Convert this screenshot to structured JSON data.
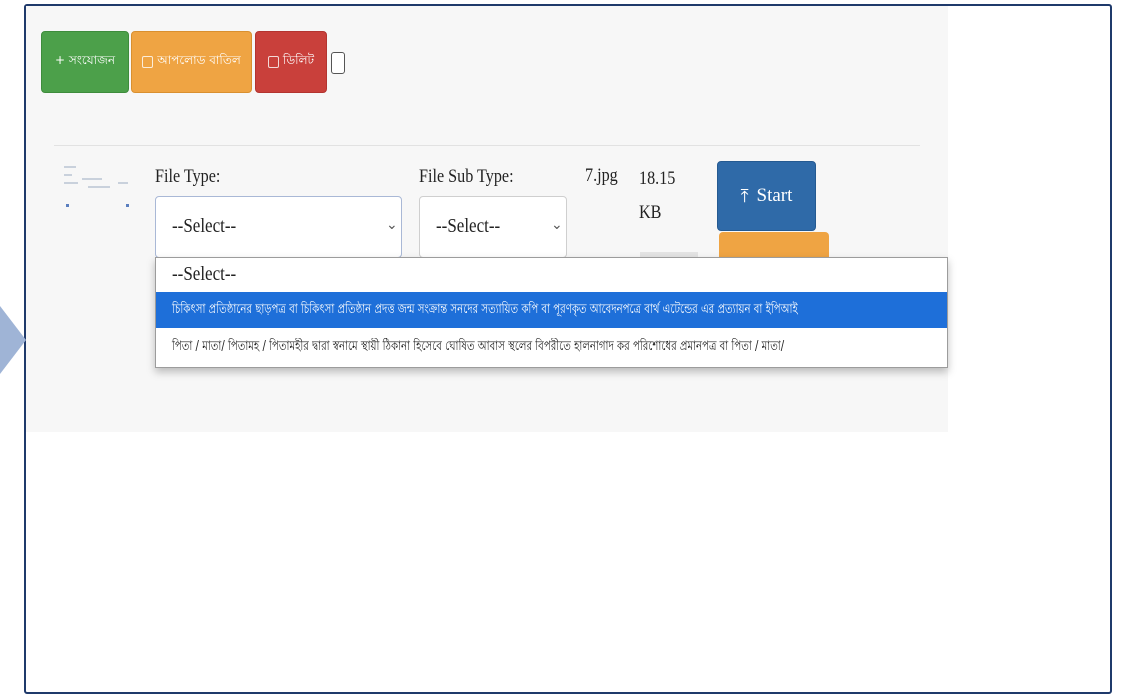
{
  "toolbar": {
    "add_label": "+ সংযোজন",
    "cancel_upload_label": "আপলোড বাতিল",
    "delete_label": "ডিলিট"
  },
  "file_row": {
    "file_type_label": "File Type:",
    "file_type_value": "--Select--",
    "file_sub_type_label": "File Sub Type:",
    "file_sub_type_value": "--Select--",
    "file_name": "7.jpg",
    "file_size": "18.15 KB",
    "start_label": "Start"
  },
  "dropdown": {
    "options": [
      "--Select--",
      "চিকিৎসা প্রতিষ্ঠানের ছাড়পত্র বা চিকিৎসা প্রতিষ্ঠান প্রদত্ত জন্ম সংক্রান্ত সনদের সত্যায়িত কপি বা পূরণকৃত আবেদনপত্রে বার্থ এটেন্ডের এর প্রত্যায়ন বা ইপিআই",
      "পিতা / মাতা/ পিতামহ / পিতামহীর দ্বারা স্বনামে স্থায়ী ঠিকানা হিসেবে ঘোষিত আবাস স্থলের বিপরীতে হালনাগাদ কর পরিশোধের প্রমানপত্র বা পিতা / মাতা/"
    ],
    "highlighted_index": 1
  },
  "colors": {
    "add": "#4ca04a",
    "cancel": "#efa443",
    "delete": "#c9403b",
    "start": "#2f6aa8",
    "highlight": "#1e6fd9"
  }
}
